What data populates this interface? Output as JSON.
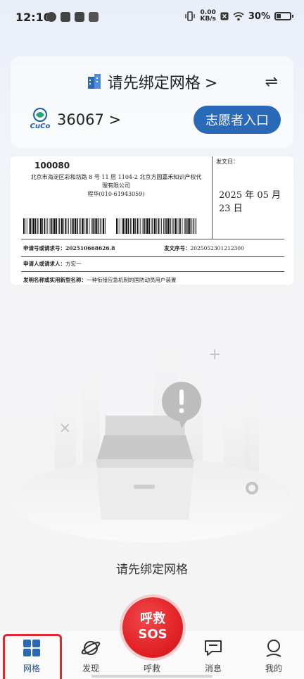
{
  "status_bar": {
    "time": "12:10",
    "net_speed_top": "0.00",
    "net_speed_bottom": "KB/s",
    "battery": "30%"
  },
  "header": {
    "title": "请先绑定网格",
    "title_chevron": ">",
    "swap_icon": "swap-icon",
    "logo_text": "CuCo",
    "count": "36067 >",
    "volunteer_button": "志愿者入口"
  },
  "document": {
    "postcode": "100080",
    "address_line1": "北京市海淀区彩和坊路 8 号 11 层 1104-2  北京方圆嘉禾知识产权代",
    "address_line2": "理有限公司",
    "address_line3": "程华(010-61943059)",
    "issue_label": "发文日：",
    "issue_date": "2025 年 05 月 23 日",
    "app_no_label": "申请号或请求号：",
    "app_no_value": "202510668626.8",
    "serial_label": "发文序号：",
    "serial_value": "2025052301212300",
    "applicant_label": "申请人或请求人：",
    "applicant_value": "方宏一",
    "invention_label": "发明名称或实用新型名称：",
    "invention_value": "一种衔接应急机制的国防动员用户装置"
  },
  "empty_state": {
    "message": "请先绑定网格"
  },
  "sos": {
    "line1": "呼救",
    "line2": "SOS"
  },
  "nav": {
    "items": [
      {
        "label": "网格",
        "icon": "grid-icon",
        "active": true
      },
      {
        "label": "发现",
        "icon": "planet-icon",
        "active": false
      },
      {
        "label": "呼救",
        "icon": "",
        "active": false
      },
      {
        "label": "消息",
        "icon": "message-icon",
        "active": false
      },
      {
        "label": "我的",
        "icon": "user-icon",
        "active": false
      }
    ]
  },
  "colors": {
    "accent": "#2a68b8",
    "sos": "#e02024",
    "active_nav": "#1f4f9a",
    "highlight": "#e0282e"
  }
}
